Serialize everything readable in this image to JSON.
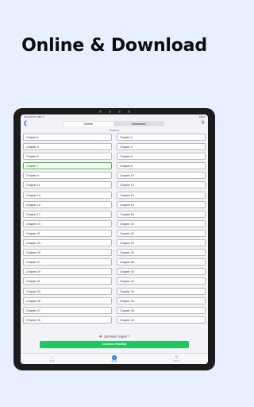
{
  "headline": "Online & Download",
  "status": {
    "time": "9:41 AM",
    "date": "Thu Mar 7",
    "app": "",
    "battery": "100%"
  },
  "nav": {
    "tabs": [
      "Online",
      "Download"
    ],
    "active": 0
  },
  "list_title": "Chapters",
  "left_chapters": [
    "Chapter 1",
    "Chapter 3",
    "Chapter 5",
    "Chapter 7",
    "Chapter 9",
    "Chapter 11",
    "Chapter 13",
    "Chapter 15",
    "Chapter 17",
    "Chapter 19",
    "Chapter 21",
    "Chapter 23",
    "Chapter 25",
    "Chapter 27",
    "Chapter 29",
    "Chapter 31",
    "Chapter 33",
    "Chapter 35",
    "Chapter 37",
    "Chapter 39"
  ],
  "right_chapters": [
    "Chapter 2",
    "Chapter 4",
    "Chapter 6",
    "Chapter 8",
    "Chapter 10",
    "Chapter 12",
    "Chapter 14",
    "Chapter 16",
    "Chapter 18",
    "Chapter 20",
    "Chapter 22",
    "Chapter 24",
    "Chapter 26",
    "Chapter 28",
    "Chapter 30",
    "Chapter 32",
    "Chapter 34",
    "Chapter 36",
    "Chapter 38",
    "Chapter 40"
  ],
  "current_chapter": "Chapter 7",
  "last_read": "Last Read: Chapter 7",
  "continue_label": "Continue Reading",
  "tabbar": [
    {
      "label": "Home",
      "icon": "home-icon"
    },
    {
      "label": "Detail",
      "icon": "book-icon"
    },
    {
      "label": "History",
      "icon": "history-icon"
    }
  ],
  "colors": {
    "accent": "#1e6ff0",
    "continue": "#22c55e",
    "heart": "#e53935",
    "current_border": "#2ecc40"
  }
}
